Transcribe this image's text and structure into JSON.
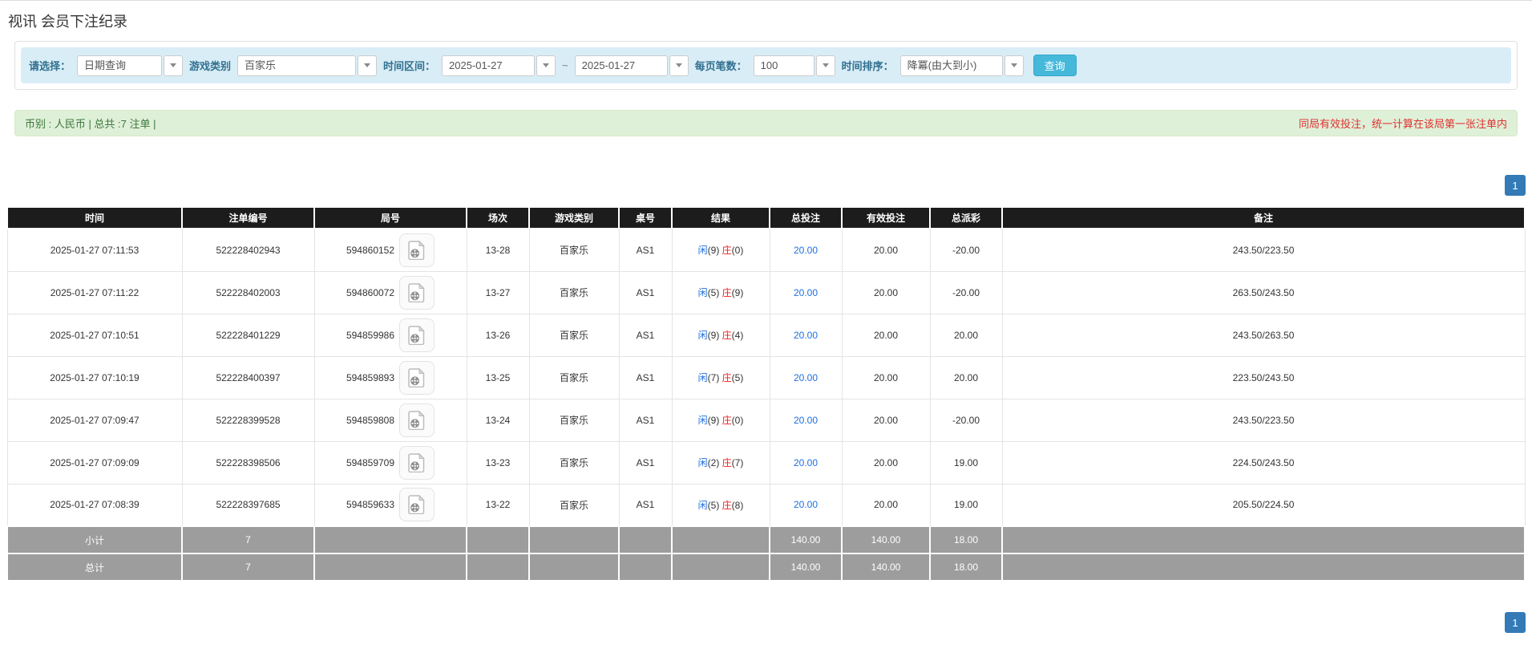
{
  "page": {
    "title": "视讯 会员下注纪录"
  },
  "filters": {
    "select_label": "请选择：",
    "select_value": "日期查询",
    "game_label": "游戏类别",
    "game_value": "百家乐",
    "range_label": "时间区间：",
    "range_from": "2025-01-27",
    "range_separator": "~",
    "range_to": "2025-01-27",
    "page_size_label": "每页笔数：",
    "page_size_value": "100",
    "sort_label": "时间排序：",
    "sort_value": "降冪(由大到小)",
    "search_button": "查询"
  },
  "summary_bar": {
    "left": "币别 : 人民币 | 总共 :7 注单 |",
    "right_note": "同局有效投注，统一计算在该局第一张注单内"
  },
  "pagination": {
    "page": "1"
  },
  "table": {
    "headers": [
      "时间",
      "注单编号",
      "局号",
      "场次",
      "游戏类别",
      "桌号",
      "结果",
      "总投注",
      "有效投注",
      "总派彩",
      "备注"
    ],
    "result_labels": {
      "player": "闲",
      "banker": "庄"
    },
    "icons": {
      "round_video_icon": "video-file-icon",
      "combo_caret": "chevron-down-icon"
    },
    "rows": [
      {
        "time": "2025-01-27 07:11:53",
        "bet_id": "522228402943",
        "round_id": "594860152",
        "session": "13-28",
        "game": "百家乐",
        "table_no": "AS1",
        "player": "9",
        "banker": "0",
        "total_bet": "20.00",
        "valid_bet": "20.00",
        "payout": "-20.00",
        "remark": "243.50/223.50"
      },
      {
        "time": "2025-01-27 07:11:22",
        "bet_id": "522228402003",
        "round_id": "594860072",
        "session": "13-27",
        "game": "百家乐",
        "table_no": "AS1",
        "player": "5",
        "banker": "9",
        "total_bet": "20.00",
        "valid_bet": "20.00",
        "payout": "-20.00",
        "remark": "263.50/243.50"
      },
      {
        "time": "2025-01-27 07:10:51",
        "bet_id": "522228401229",
        "round_id": "594859986",
        "session": "13-26",
        "game": "百家乐",
        "table_no": "AS1",
        "player": "9",
        "banker": "4",
        "total_bet": "20.00",
        "valid_bet": "20.00",
        "payout": "20.00",
        "remark": "243.50/263.50"
      },
      {
        "time": "2025-01-27 07:10:19",
        "bet_id": "522228400397",
        "round_id": "594859893",
        "session": "13-25",
        "game": "百家乐",
        "table_no": "AS1",
        "player": "7",
        "banker": "5",
        "total_bet": "20.00",
        "valid_bet": "20.00",
        "payout": "20.00",
        "remark": "223.50/243.50"
      },
      {
        "time": "2025-01-27 07:09:47",
        "bet_id": "522228399528",
        "round_id": "594859808",
        "session": "13-24",
        "game": "百家乐",
        "table_no": "AS1",
        "player": "9",
        "banker": "0",
        "total_bet": "20.00",
        "valid_bet": "20.00",
        "payout": "-20.00",
        "remark": "243.50/223.50"
      },
      {
        "time": "2025-01-27 07:09:09",
        "bet_id": "522228398506",
        "round_id": "594859709",
        "session": "13-23",
        "game": "百家乐",
        "table_no": "AS1",
        "player": "2",
        "banker": "7",
        "total_bet": "20.00",
        "valid_bet": "20.00",
        "payout": "19.00",
        "remark": "224.50/243.50"
      },
      {
        "time": "2025-01-27 07:08:39",
        "bet_id": "522228397685",
        "round_id": "594859633",
        "session": "13-22",
        "game": "百家乐",
        "table_no": "AS1",
        "player": "5",
        "banker": "8",
        "total_bet": "20.00",
        "valid_bet": "20.00",
        "payout": "19.00",
        "remark": "205.50/224.50"
      }
    ],
    "subtotal": {
      "label": "小计",
      "count": "7",
      "total_bet": "140.00",
      "valid_bet": "140.00",
      "payout": "18.00"
    },
    "total": {
      "label": "总计",
      "count": "7",
      "total_bet": "140.00",
      "valid_bet": "140.00",
      "payout": "18.00"
    }
  },
  "colors": {
    "filter_bar_bg": "#d9edf7",
    "filter_label": "#31708f",
    "search_button_bg": "#46b8da",
    "notice_bg": "#dff0d8",
    "notice_text": "#3c763d",
    "notice_warning_red": "#e03131",
    "table_header_bg": "#1c1c1c",
    "summary_row_bg": "#9d9d9d",
    "link_blue": "#1e6fdf",
    "player_blue": "#1e6fdf",
    "banker_red": "#ed1d1d",
    "negative_red": "#ed1d1d",
    "pagination_bg": "#337ab7"
  }
}
